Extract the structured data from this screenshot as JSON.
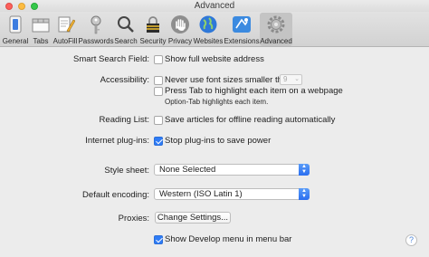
{
  "window": {
    "title": "Advanced"
  },
  "toolbar": {
    "items": [
      {
        "label": "General",
        "icon": "general-switch-icon",
        "selected": false
      },
      {
        "label": "Tabs",
        "icon": "tabs-icon",
        "selected": false
      },
      {
        "label": "AutoFill",
        "icon": "autofill-pencil-icon",
        "selected": false
      },
      {
        "label": "Passwords",
        "icon": "key-icon",
        "selected": false
      },
      {
        "label": "Search",
        "icon": "magnifier-icon",
        "selected": false
      },
      {
        "label": "Security",
        "icon": "lock-icon",
        "selected": false
      },
      {
        "label": "Privacy",
        "icon": "hand-icon",
        "selected": false
      },
      {
        "label": "Websites",
        "icon": "globe-icon",
        "selected": false
      },
      {
        "label": "Extensions",
        "icon": "puzzle-icon",
        "selected": false
      },
      {
        "label": "Advanced",
        "icon": "gear-icon",
        "selected": true
      }
    ]
  },
  "settings": {
    "smart_search": {
      "label": "Smart Search Field:",
      "option": "Show full website address",
      "checked": false
    },
    "accessibility": {
      "label": "Accessibility:",
      "font_option": "Never use font sizes smaller than",
      "font_size": "9",
      "font_checked": false,
      "tab_option": "Press Tab to highlight each item on a webpage",
      "tab_checked": false,
      "tab_note": "Option-Tab highlights each item."
    },
    "reading_list": {
      "label": "Reading List:",
      "option": "Save articles for offline reading automatically",
      "checked": false
    },
    "plugins": {
      "label": "Internet plug-ins:",
      "option": "Stop plug-ins to save power",
      "checked": true
    },
    "style_sheet": {
      "label": "Style sheet:",
      "value": "None Selected"
    },
    "encoding": {
      "label": "Default encoding:",
      "value": "Western (ISO Latin 1)"
    },
    "proxies": {
      "label": "Proxies:",
      "button": "Change Settings..."
    },
    "develop": {
      "option": "Show Develop menu in menu bar",
      "checked": true
    }
  },
  "help": {
    "label": "?"
  },
  "colors": {
    "accent": "#2f7cf6",
    "toolbar_selected": "#c4c4c4"
  }
}
